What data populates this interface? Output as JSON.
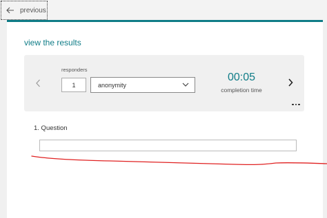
{
  "toolbar": {
    "previous_label": "previous",
    "back_icon": "arrow-left-icon"
  },
  "page": {
    "title": "view the results",
    "accent_color": "#0f7c87"
  },
  "summary": {
    "responders_label": "responders",
    "responder_value": "1",
    "responder_select": {
      "selected": "anonymity"
    },
    "time_value": "00:05",
    "time_label": "completion time",
    "prev_icon": "chevron-left-icon",
    "next_icon": "chevron-right-icon",
    "more_icon": "more-dots-icon"
  },
  "question": {
    "label": "1. Question",
    "answer": ""
  },
  "annotation": {
    "color": "#e02020",
    "kind": "hand-drawn red underline"
  }
}
